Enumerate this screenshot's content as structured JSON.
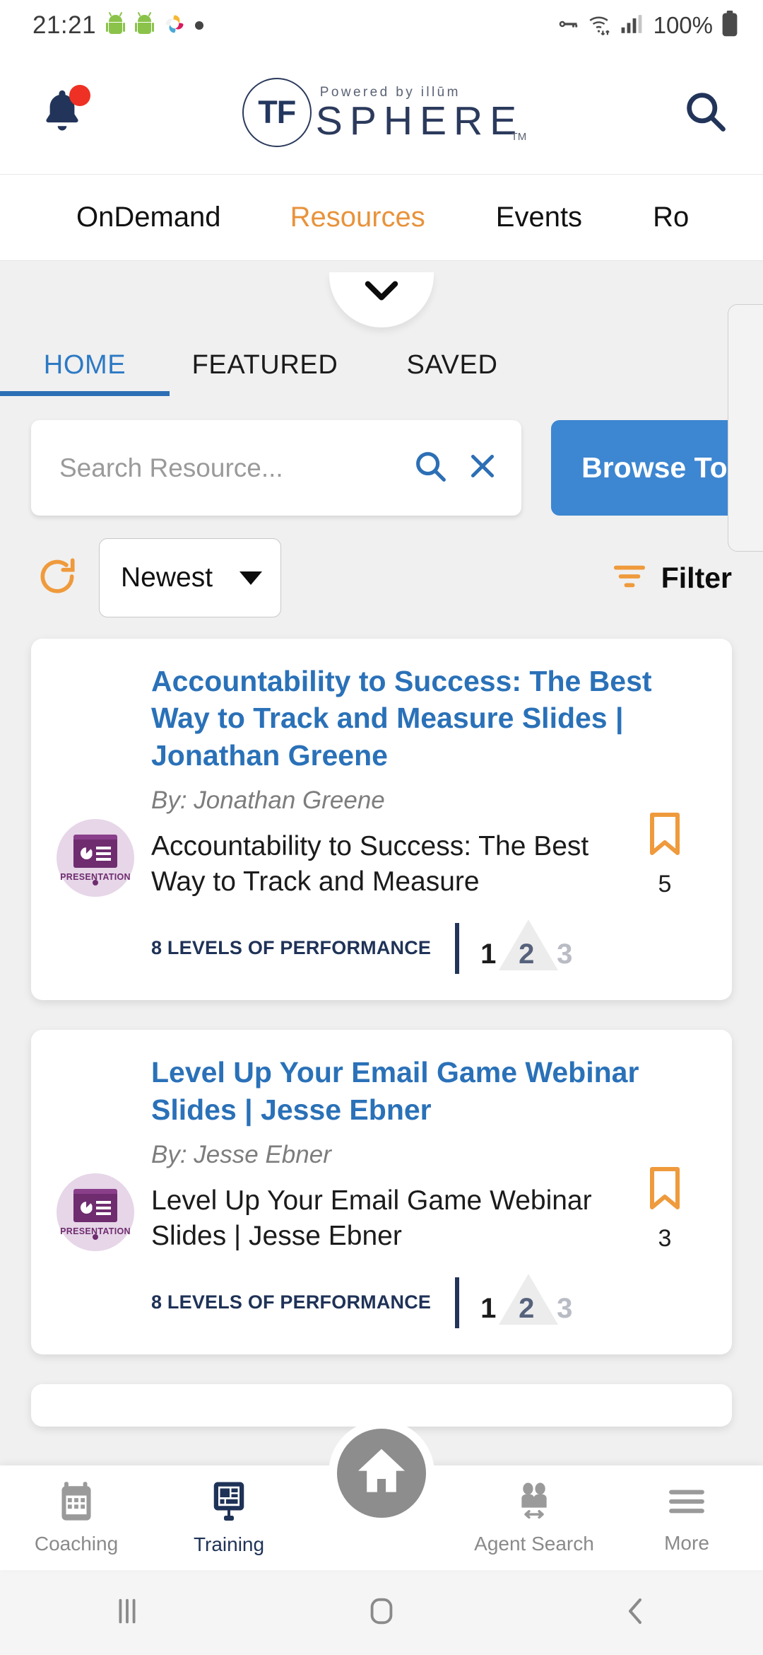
{
  "status_bar": {
    "time": "21:21",
    "battery_percent": "100%",
    "icons": [
      "android-icon",
      "android-icon",
      "photos-icon",
      "dot-icon",
      "vpn-key-icon",
      "wifi-icon",
      "cellular-signal-icon",
      "battery-icon"
    ]
  },
  "header": {
    "notification_label": "notifications-bell",
    "has_notification_badge": true,
    "logo": {
      "mark": "TF",
      "powered_by": "Powered by illūm",
      "wordmark": "SPHERE",
      "trademark": "TM"
    },
    "search_label": "search"
  },
  "top_nav": {
    "items": [
      {
        "label": "OnDemand",
        "active": false
      },
      {
        "label": "Resources",
        "active": true
      },
      {
        "label": "Events",
        "active": false
      },
      {
        "label": "Ro",
        "active": false
      }
    ]
  },
  "collapse_control": {
    "icon": "chevron-down-icon"
  },
  "sub_tabs": {
    "items": [
      {
        "label": "HOME",
        "active": true
      },
      {
        "label": "FEATURED",
        "active": false
      },
      {
        "label": "SAVED",
        "active": false
      }
    ]
  },
  "search": {
    "value": "",
    "placeholder": "Search Resource...",
    "search_icon": "search-icon",
    "clear_icon": "close-icon"
  },
  "browse_topic": {
    "label": "Browse Topic"
  },
  "toolbar": {
    "refresh_icon": "refresh-icon",
    "sort_value": "Newest",
    "sort_options": [
      "Newest"
    ],
    "filter_label": "Filter",
    "filter_icon": "filter-icon"
  },
  "colors": {
    "accent_orange": "#e8933c",
    "accent_blue": "#3d86d1",
    "link_blue": "#2a71b8",
    "navy": "#1f3257",
    "purple": "#6f2c6f",
    "bookmark_orange": "#ef9a3c"
  },
  "resources": [
    {
      "title": "Accountability to Success: The Best Way to Track and Measure Slides | Jonathan Greene",
      "byline": "By: Jonathan Greene",
      "description": "Accountability to Success: The Best Way to Track and Measure",
      "type_label": "PRESENTATION",
      "type_icon": "presentation-icon",
      "badge": {
        "text": "8 LEVELS OF PERFORMANCE",
        "levels": [
          "1",
          "2",
          "3"
        ]
      },
      "bookmark_count": "5",
      "bookmark_icon": "bookmark-icon"
    },
    {
      "title": "Level Up Your Email Game Webinar Slides | Jesse Ebner",
      "byline": "By: Jesse Ebner",
      "description": "Level Up Your Email Game Webinar Slides | Jesse Ebner",
      "type_label": "PRESENTATION",
      "type_icon": "presentation-icon",
      "badge": {
        "text": "8 LEVELS OF PERFORMANCE",
        "levels": [
          "1",
          "2",
          "3"
        ]
      },
      "bookmark_count": "3",
      "bookmark_icon": "bookmark-icon"
    }
  ],
  "bottom_nav": {
    "items": [
      {
        "label": "Coaching",
        "icon": "calendar-icon",
        "active": false
      },
      {
        "label": "Training",
        "icon": "monitor-icon",
        "active": true
      },
      {
        "label": "Agent Search",
        "icon": "people-search-icon",
        "active": false
      },
      {
        "label": "More",
        "icon": "hamburger-menu-icon",
        "active": false
      }
    ],
    "home_button": {
      "icon": "home-icon"
    }
  },
  "android_nav": {
    "recents": "recents-icon",
    "home": "home-square-icon",
    "back": "back-chevron-icon"
  }
}
